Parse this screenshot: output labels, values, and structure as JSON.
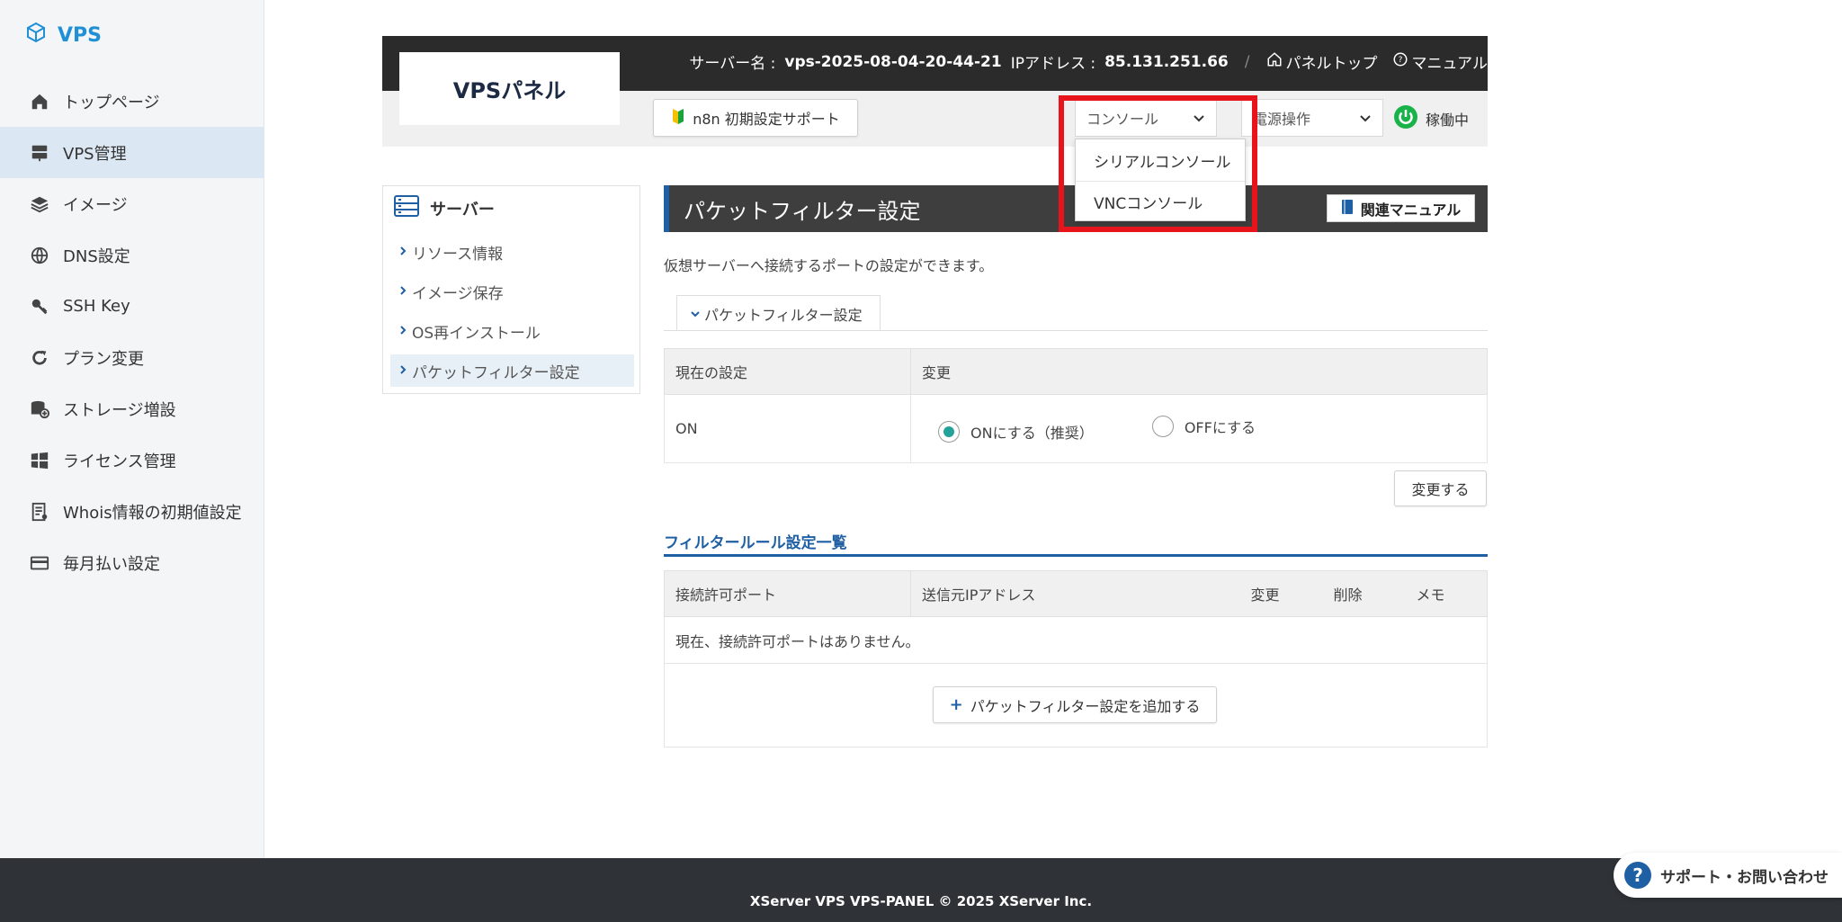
{
  "sidebar": {
    "brand": "VPS",
    "items": [
      {
        "label": "トップページ"
      },
      {
        "label": "VPS管理"
      },
      {
        "label": "イメージ"
      },
      {
        "label": "DNS設定"
      },
      {
        "label": "SSH Key"
      },
      {
        "label": "プラン変更"
      },
      {
        "label": "ストレージ増設"
      },
      {
        "label": "ライセンス管理"
      },
      {
        "label": "Whois情報の初期値設定"
      },
      {
        "label": "毎月払い設定"
      }
    ]
  },
  "header": {
    "logo": "VPSパネル",
    "server_name_label": "サーバー名 :",
    "server_name": "vps-2025-08-04-20-44-21",
    "ip_label": "IPアドレス :",
    "ip": "85.131.251.66",
    "separator": "/",
    "panel_top": "パネルトップ",
    "manual": "マニュアル",
    "n8n_button": "n8n 初期設定サポート",
    "console_select": "コンソール",
    "power_select": "電源操作",
    "status": "稼働中"
  },
  "console_dropdown": {
    "options": [
      "シリアルコンソール",
      "VNCコンソール"
    ]
  },
  "submenu": {
    "title": "サーバー",
    "items": [
      {
        "label": "リソース情報"
      },
      {
        "label": "イメージ保存"
      },
      {
        "label": "OS再インストール"
      },
      {
        "label": "パケットフィルター設定"
      }
    ]
  },
  "main": {
    "title": "パケットフィルター設定",
    "manual_button": "関連マニュアル",
    "description": "仮想サーバーへ接続するポートの設定ができます。",
    "tab": "パケットフィルター設定",
    "settings_table": {
      "headers": [
        "現在の設定",
        "変更"
      ],
      "current": "ON",
      "option_on": "ONにする（推奨）",
      "option_off": "OFFにする"
    },
    "change_button": "変更する",
    "rules_title": "フィルタールール設定一覧",
    "rules_table": {
      "headers": [
        "接続許可ポート",
        "送信元IPアドレス",
        "変更",
        "削除",
        "メモ"
      ],
      "empty": "現在、接続許可ポートはありません。"
    },
    "add_button": "パケットフィルター設定を追加する"
  },
  "footer": {
    "copyright": "XServer VPS VPS-PANEL © 2025 XServer Inc.",
    "support": "サポート・お問い合わせ"
  },
  "colors": {
    "accent": "#1f5fa3",
    "highlight": "#e8141b",
    "radio": "#23a29a",
    "status": "#19b34a"
  }
}
